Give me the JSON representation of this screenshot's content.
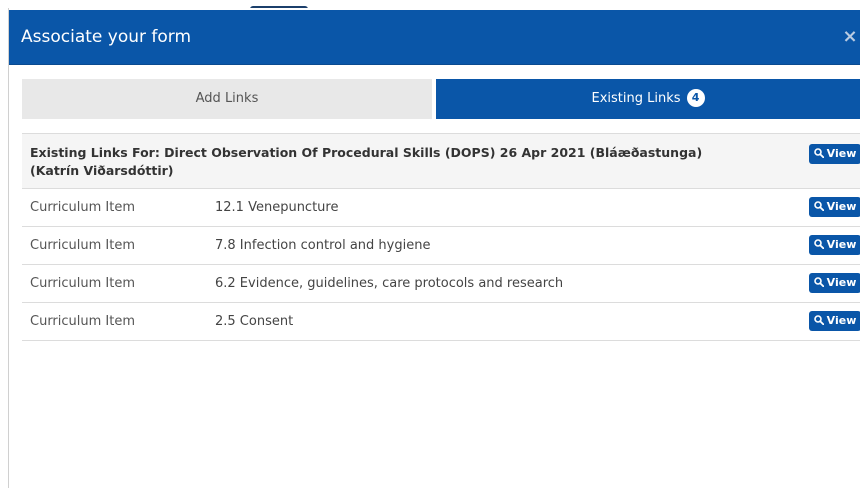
{
  "modal": {
    "title": "Associate your form",
    "close_glyph": "×"
  },
  "tabs": [
    {
      "label": "Add Links",
      "active": false
    },
    {
      "label": "Existing Links",
      "active": true,
      "count": "4"
    }
  ],
  "panel": {
    "heading": "Existing Links For: Direct Observation Of Procedural Skills (DOPS) 26 Apr 2021 (Bláæðastunga) (Katrín Viðarsdóttir)",
    "heading_button": "View"
  },
  "rows": [
    {
      "type": "Curriculum Item",
      "name": "12.1 Venepuncture",
      "button": "View"
    },
    {
      "type": "Curriculum Item",
      "name": "7.8 Infection control and hygiene",
      "button": "View"
    },
    {
      "type": "Curriculum Item",
      "name": "6.2 Evidence, guidelines, care protocols and research",
      "button": "View"
    },
    {
      "type": "Curriculum Item",
      "name": "2.5 Consent",
      "button": "View"
    }
  ],
  "colors": {
    "primary": "#0a56a8",
    "tab_inactive": "#e8e8e8",
    "heading_bg": "#f5f5f5"
  },
  "icons": {
    "view_button": "search-icon",
    "close": "close-icon"
  }
}
